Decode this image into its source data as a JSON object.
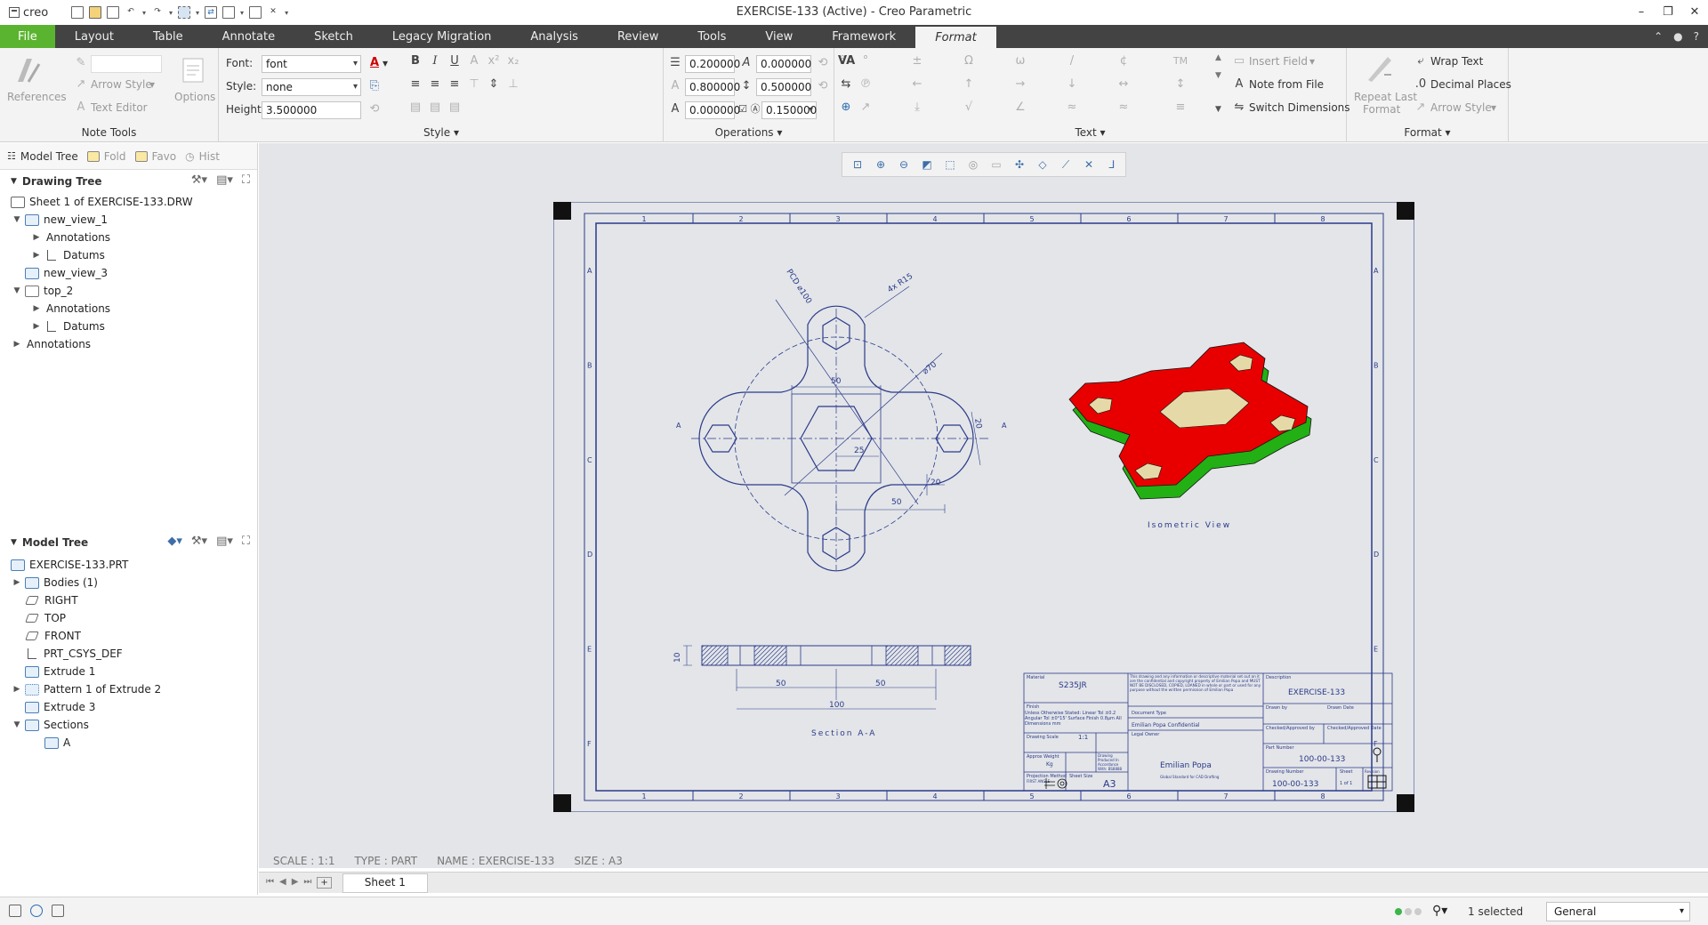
{
  "app": {
    "logo": "creo",
    "window_title": "EXERCISE-133 (Active) - Creo Parametric"
  },
  "menu": {
    "tabs": [
      "File",
      "Layout",
      "Table",
      "Annotate",
      "Sketch",
      "Legacy Migration",
      "Analysis",
      "Review",
      "Tools",
      "View",
      "Framework",
      "Format"
    ],
    "active_tab": "Format"
  },
  "ribbon": {
    "note_tools": {
      "label": "Note Tools",
      "references": "References",
      "arrow_style": "Arrow Style",
      "text_editor": "Text Editor",
      "options": "Options"
    },
    "style": {
      "label": "Style",
      "font_label": "Font:",
      "font_value": "font",
      "style_label": "Style:",
      "style_value": "none",
      "height_label": "Height:",
      "height_value": "3.500000"
    },
    "operations": {
      "label": "Operations",
      "v1": "0.200000",
      "v2": "0.000000",
      "v3": "0.800000",
      "v4": "0.500000",
      "v5": "0.000000",
      "v6": "0.150000"
    },
    "text": {
      "label": "Text",
      "insert_field": "Insert Field",
      "note_from_file": "Note from File",
      "switch_dimensions": "Switch Dimensions",
      "tm": "TM"
    },
    "format": {
      "label": "Format",
      "repeat_last": "Repeat Last",
      "format_word": "Format",
      "wrap_text": "Wrap Text",
      "decimal_places": "Decimal Places",
      "arrow_style": "Arrow Style"
    }
  },
  "left_panel": {
    "tabs": [
      "Model Tree",
      "Fold",
      "Favo",
      "Hist"
    ],
    "drawing_tree": {
      "title": "Drawing Tree",
      "items": [
        "Sheet 1 of EXERCISE-133.DRW",
        "new_view_1",
        "Annotations",
        "Datums",
        "new_view_3",
        "top_2",
        "Annotations",
        "Datums",
        "Annotations"
      ]
    },
    "model_tree": {
      "title": "Model Tree",
      "items": [
        "EXERCISE-133.PRT",
        "Bodies (1)",
        "RIGHT",
        "TOP",
        "FRONT",
        "PRT_CSYS_DEF",
        "Extrude 1",
        "Pattern 1 of Extrude 2",
        "Extrude 3",
        "Sections",
        "A"
      ]
    }
  },
  "drawing": {
    "zone_cols": [
      "1",
      "2",
      "3",
      "4",
      "5",
      "6",
      "7",
      "8"
    ],
    "zone_rows": [
      "A",
      "B",
      "C",
      "D",
      "E",
      "F"
    ],
    "dims": {
      "pcd": "PCD ⌀100",
      "r15": "4x R15",
      "d70": "⌀70",
      "d50": "50",
      "d25": "25",
      "d20a": "20",
      "d20b": "20",
      "d50b": "50",
      "d10": "10",
      "s50a": "50",
      "s50b": "50",
      "s100": "100",
      "a": "A"
    },
    "section_label": "Section A-A",
    "iso_label": "Isometric View",
    "colors": {
      "iso_top": "#e80000",
      "iso_side": "#22b014",
      "iso_hole": "#e6d9a8",
      "line": "#2b3a8a"
    },
    "title_block": {
      "material_label": "Material",
      "material": "S235JR",
      "finish_label": "Finish",
      "tol_text": "Unless Otherwise Stated: Linear Tol ±0.2 Angular Tol ±0°15' Surface Finish 0.8μm All Dimensions mm",
      "scale_label": "Drawing Scale",
      "scale": "1:1",
      "weight_label": "Approx Weight",
      "weight": "Kg",
      "produced": "Drawing Produced In Accordance With: BS8888",
      "proj_label": "Projection Method",
      "proj": "FIRST ANGLE",
      "sheet_size_label": "Sheet Size",
      "sheet_size": "A3",
      "conf_text": "This drawing and any information or descriptive material set out on it are the confidential and copyright property of Emilian Popa and MUST NOT BE DISCLOSED, COPIED, LOANED in whole or part or used for any purpose without the written permission of Emilian Popa",
      "doc_type_label": "Document Type",
      "confidential": "Emilian Popa Confidential",
      "legal_owner_label": "Legal Owner",
      "owner": "Emilian Popa",
      "owner_sub": "Global Standard for CAD Drafting",
      "desc_label": "Description",
      "description": "EXERCISE-133",
      "drawn_by": "Drawn by",
      "drawn_date": "Drawn Date",
      "checked_by": "Checked/Approved by",
      "checked_date": "Checked/Approved Date",
      "part_number_label": "Part Number",
      "part_number": "100-00-133",
      "drawing_number_label": "Drawing Number",
      "drawing_number": "100-00-133",
      "sheet_label": "Sheet",
      "sheet": "1 of 1",
      "revision_label": "Revision"
    }
  },
  "status_info": {
    "scale": "SCALE : 1:1",
    "type": "TYPE : PART",
    "name": "NAME : EXERCISE-133",
    "size": "SIZE : A3"
  },
  "sheet_tab": "Sheet 1",
  "statusbar": {
    "selected": "1 selected",
    "filter": "General"
  }
}
